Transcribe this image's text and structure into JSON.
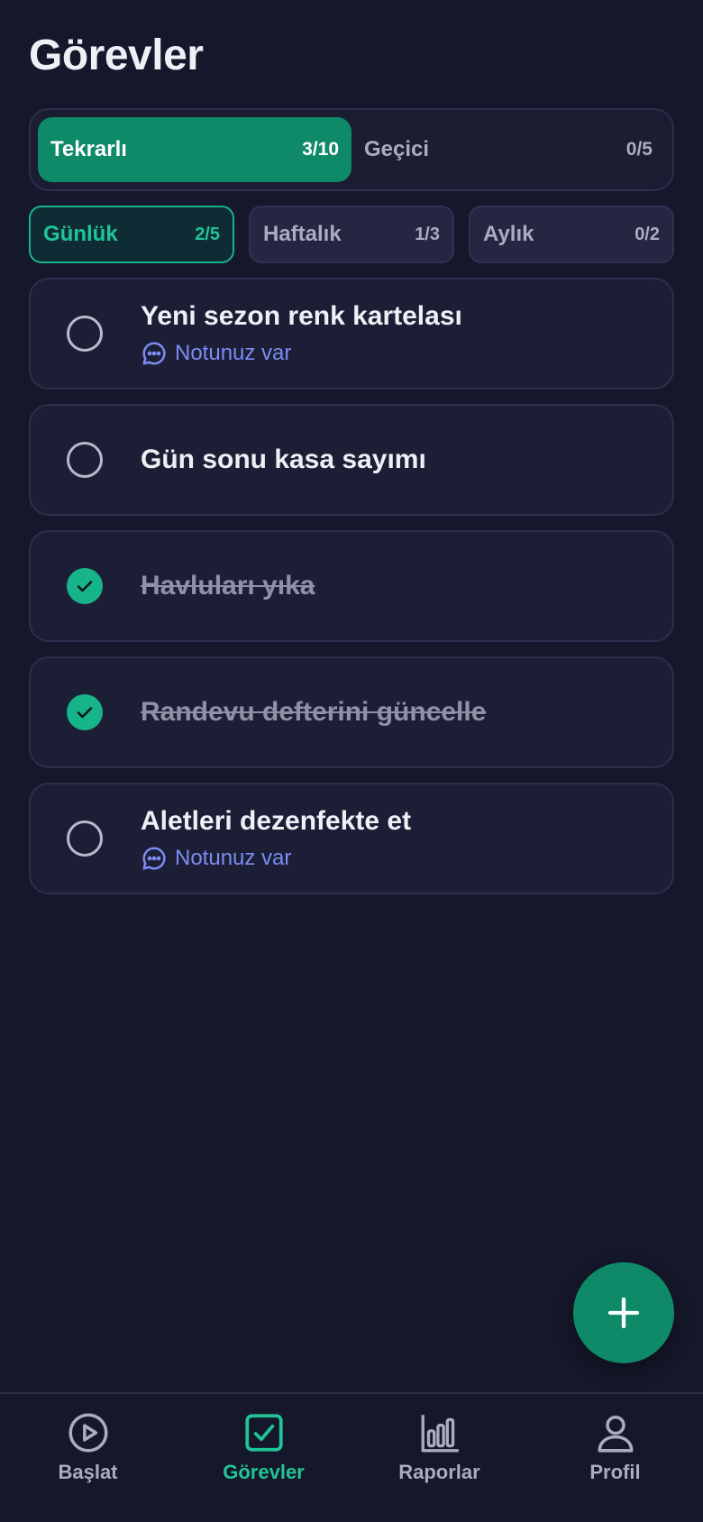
{
  "header": {
    "title": "Görevler"
  },
  "type_tabs": [
    {
      "label": "Tekrarlı",
      "count": "3/10",
      "active": true
    },
    {
      "label": "Geçici",
      "count": "0/5",
      "active": false
    }
  ],
  "period_tabs": [
    {
      "label": "Günlük",
      "count": "2/5",
      "active": true
    },
    {
      "label": "Haftalık",
      "count": "1/3",
      "active": false
    },
    {
      "label": "Aylık",
      "count": "0/2",
      "active": false
    }
  ],
  "tasks": [
    {
      "title": "Yeni sezon renk kartelası",
      "done": false,
      "note": "Notunuz var"
    },
    {
      "title": "Gün sonu kasa sayımı",
      "done": false
    },
    {
      "title": "Havluları yıka",
      "done": true
    },
    {
      "title": "Randevu defterini güncelle",
      "done": true
    },
    {
      "title": "Aletleri dezenfekte et",
      "done": false,
      "note": "Notunuz var"
    }
  ],
  "fab": {
    "icon": "plus-icon"
  },
  "bottom_nav": [
    {
      "label": "Başlat",
      "icon": "play-circle-icon",
      "active": false
    },
    {
      "label": "Görevler",
      "icon": "check-square-icon",
      "active": true
    },
    {
      "label": "Raporlar",
      "icon": "bar-chart-icon",
      "active": false
    },
    {
      "label": "Profil",
      "icon": "user-icon",
      "active": false
    }
  ],
  "colors": {
    "background": "#15172a",
    "card": "#1c1e35",
    "accent": "#0e8a68",
    "accent_text": "#20c596",
    "note": "#7b8cf3"
  }
}
